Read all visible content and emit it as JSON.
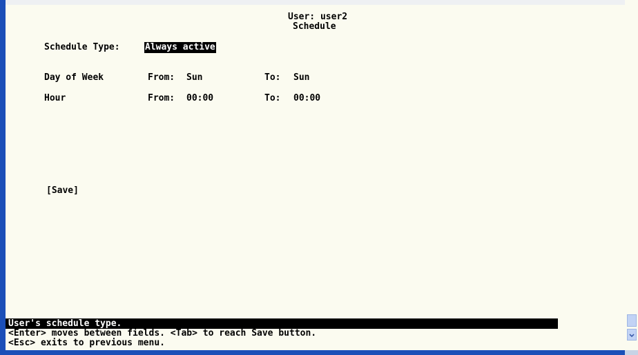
{
  "header": {
    "user_line": "User: user2",
    "title": "Schedule"
  },
  "schedule_type": {
    "label": "Schedule Type:",
    "value": "Always active"
  },
  "day_of_week": {
    "label": "Day of Week",
    "from_label": "From:",
    "from_value": "Sun",
    "to_label": "To:",
    "to_value": "Sun"
  },
  "hour": {
    "label": "Hour",
    "from_label": "From:",
    "from_value": "00:00",
    "to_label": "To:",
    "to_value": "00:00"
  },
  "save_label": "[Save]",
  "status": {
    "description": "User's schedule type.",
    "help_line1": "<Enter> moves between fields. <Tab> to reach Save button.",
    "help_line2": "<Esc> exits to previous menu."
  },
  "icons": {
    "scroll_down": "chevron-down-icon"
  },
  "colors": {
    "background": "#fbfbf0",
    "text": "#000000",
    "highlight_bg": "#000000",
    "highlight_fg": "#ffffff",
    "window_border": "#1b4fb8"
  }
}
